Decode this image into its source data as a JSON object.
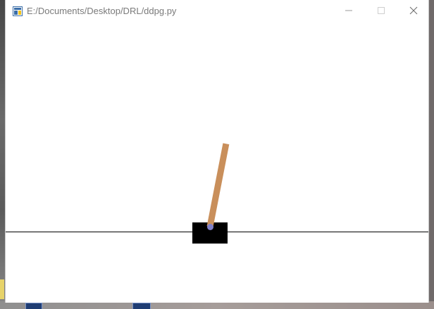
{
  "window": {
    "title": "E:/Documents/Desktop/DRL/ddpg.py",
    "app_icon": "python-icon",
    "controls": {
      "minimize_icon": "minimize-icon",
      "maximize_icon": "maximize-icon",
      "close_icon": "close-icon"
    }
  },
  "scene": {
    "environment": "cartpole",
    "colors": {
      "background": "#ffffff",
      "track": "#000000",
      "cart": "#000000",
      "pole": "#c98f5b",
      "axle": "#8080c8"
    }
  },
  "taskbar": {
    "icons": [
      "taskbar-item-icon",
      "taskbar-item-icon"
    ]
  }
}
